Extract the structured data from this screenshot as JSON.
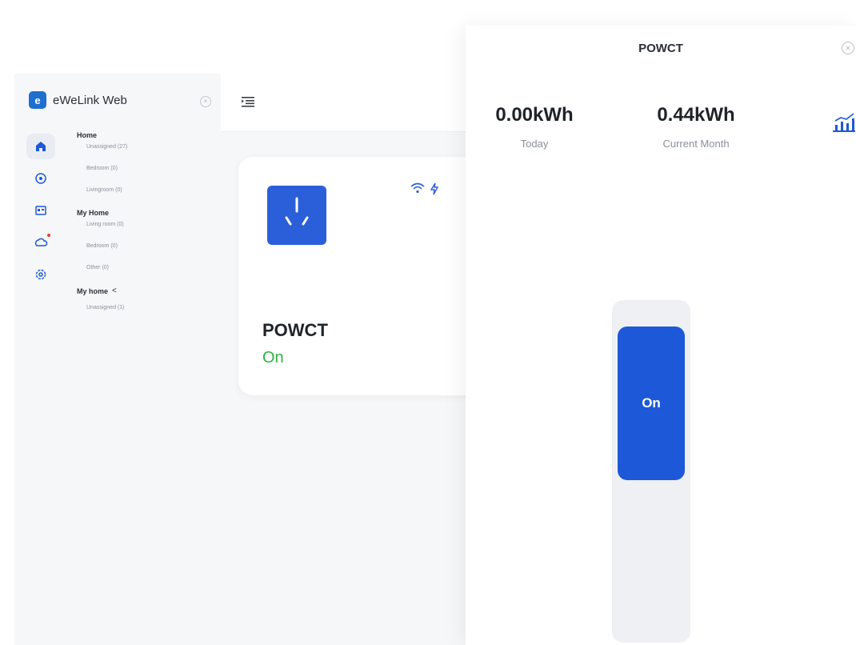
{
  "app": {
    "logo_letter": "e",
    "name": "eWeLink Web"
  },
  "nav_rail": [
    {
      "icon": "home-icon",
      "active": true
    },
    {
      "icon": "scene-icon",
      "active": false
    },
    {
      "icon": "gallery-icon",
      "active": false
    },
    {
      "icon": "cloud-icon",
      "active": false,
      "badge": true
    },
    {
      "icon": "settings-icon",
      "active": false
    }
  ],
  "tree": {
    "home": {
      "title": "Home",
      "items": [
        "Unassigned (27)",
        "Bedroom (0)",
        "Livingroom (0)"
      ]
    },
    "my_home": {
      "title": "My Home",
      "items": [
        "Living room (0)",
        "Bedroom (0)",
        "Other (0)"
      ]
    },
    "my_home_shared": {
      "title": "My home",
      "items": [
        "Unassigned (1)"
      ]
    }
  },
  "device_card": {
    "name": "POWCT",
    "state": "On",
    "icons": [
      "wifi-icon",
      "lightning-icon"
    ]
  },
  "drawer": {
    "title": "POWCT",
    "today_value": "0.00kWh",
    "today_label": "Today",
    "month_value": "0.44kWh",
    "month_label": "Current Month",
    "switch_label": "On",
    "switch_state": "on"
  },
  "colors": {
    "accent": "#1d58d8",
    "on_green": "#2fb344",
    "badge_red": "#e53935"
  }
}
